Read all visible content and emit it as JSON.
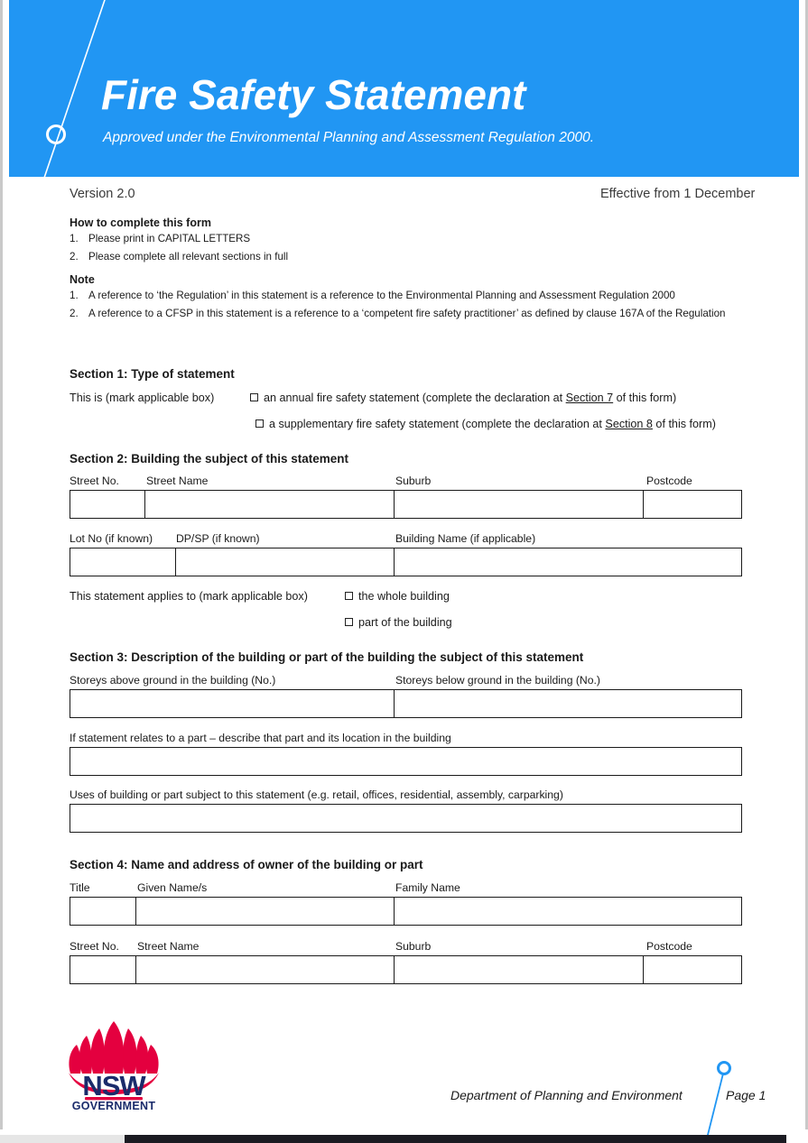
{
  "document": {
    "title": "Fire Safety Statement",
    "subtitle": "Approved under the Environmental Planning and Assessment Regulation 2000.",
    "version": "Version 2.0",
    "effective": "Effective from 1 December"
  },
  "colors": {
    "banner_blue": "#2196f3",
    "logo_red": "#e4003f",
    "logo_navy": "#1a2b6b",
    "accent_line": "#2196f3",
    "text": "#1a1a1a"
  },
  "instructions": {
    "how_to_heading": "How to complete this form",
    "how_to_items": [
      {
        "num": "1.",
        "text": "Please print in CAPITAL LETTERS"
      },
      {
        "num": "2.",
        "text": "Please complete all relevant sections in full"
      }
    ],
    "note_heading": "Note",
    "note_items": [
      {
        "num": "1.",
        "text": "A reference to ‘the Regulation’ in this statement is a reference to the Environmental Planning and Assessment Regulation 2000"
      },
      {
        "num": "2.",
        "text": "A reference to a CFSP in this statement is a reference to a ‘competent fire safety practitioner’ as defined by clause 167A of the Regulation"
      }
    ]
  },
  "section1": {
    "title": "Section 1: Type of statement",
    "prompt": "This is (mark applicable box)",
    "option1_pre": "an annual fire safety statement (complete the declaration at ",
    "option1_link": "Section 7",
    "option1_post": " of this form)",
    "option2_pre": "a supplementary fire safety statement (complete the declaration at ",
    "option2_link": "Section 8",
    "option2_post": " of this form)"
  },
  "section2": {
    "title": "Section 2: Building the subject of this statement",
    "row1_labels": [
      "Street No.",
      "Street Name",
      "Suburb",
      "Postcode"
    ],
    "row2_labels": [
      "Lot No (if known)",
      "DP/SP (if known)",
      "Building Name (if applicable)"
    ],
    "applies_prompt": "This statement applies to (mark applicable box)",
    "applies_option1": "the whole building",
    "applies_option2": "part of the building"
  },
  "section3": {
    "title": "Section 3: Description of the building or part of the building the subject of this statement",
    "label_above": "Storeys above ground in the building (No.)",
    "label_below": "Storeys below ground in the building (No.)",
    "label_part": "If statement relates to a part – describe that part and its location in the building",
    "label_uses": "Uses of building or part subject to this statement (e.g. retail, offices, residential, assembly, carparking)"
  },
  "section4": {
    "title": "Section 4: Name and address of owner of the building or part",
    "row1_labels": [
      "Title",
      "Given Name/s",
      "Family Name"
    ],
    "row2_labels": [
      "Street No.",
      "Street Name",
      "Suburb",
      "Postcode"
    ]
  },
  "footer": {
    "logo_name": "NSW",
    "logo_sub": "GOVERNMENT",
    "department": "Department of Planning and Environment",
    "page": "Page 1"
  }
}
